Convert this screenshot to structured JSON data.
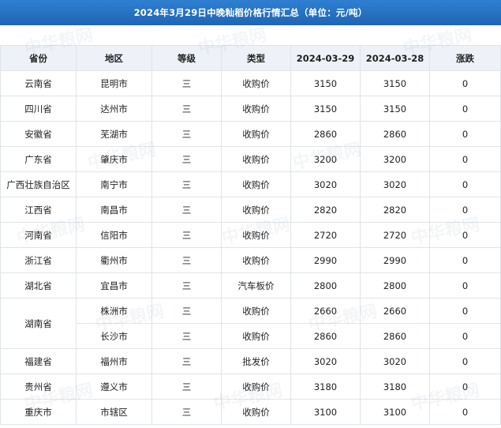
{
  "title": "2024年3月29日中晚籼稻价格行情汇总（单位：元/吨）",
  "watermark_text": "中华粮网",
  "headers": [
    "省份",
    "地区",
    "等级",
    "类型",
    "2024-03-29",
    "2024-03-28",
    "涨跌"
  ],
  "rows": [
    {
      "province": "云南省",
      "area": "昆明市",
      "grade": "三",
      "type": "收购价",
      "d1": "3150",
      "d2": "3150",
      "change": "0"
    },
    {
      "province": "四川省",
      "area": "达州市",
      "grade": "三",
      "type": "收购价",
      "d1": "3150",
      "d2": "3150",
      "change": "0"
    },
    {
      "province": "安徽省",
      "area": "芜湖市",
      "grade": "三",
      "type": "收购价",
      "d1": "2860",
      "d2": "2860",
      "change": "0"
    },
    {
      "province": "广东省",
      "area": "肇庆市",
      "grade": "三",
      "type": "收购价",
      "d1": "3200",
      "d2": "3200",
      "change": "0"
    },
    {
      "province": "广西壮族自治区",
      "area": "南宁市",
      "grade": "三",
      "type": "收购价",
      "d1": "3020",
      "d2": "3020",
      "change": "0"
    },
    {
      "province": "江西省",
      "area": "南昌市",
      "grade": "三",
      "type": "收购价",
      "d1": "2820",
      "d2": "2820",
      "change": "0"
    },
    {
      "province": "河南省",
      "area": "信阳市",
      "grade": "三",
      "type": "收购价",
      "d1": "2720",
      "d2": "2720",
      "change": "0"
    },
    {
      "province": "浙江省",
      "area": "衢州市",
      "grade": "三",
      "type": "收购价",
      "d1": "2990",
      "d2": "2990",
      "change": "0"
    },
    {
      "province": "湖北省",
      "area": "宜昌市",
      "grade": "三",
      "type": "汽车板价",
      "d1": "2800",
      "d2": "2800",
      "change": "0"
    },
    {
      "province": "湖南省",
      "area": "株洲市",
      "grade": "三",
      "type": "收购价",
      "d1": "2660",
      "d2": "2660",
      "change": "0"
    },
    {
      "province": "",
      "area": "长沙市",
      "grade": "三",
      "type": "收购价",
      "d1": "2860",
      "d2": "2860",
      "change": "0"
    },
    {
      "province": "福建省",
      "area": "福州市",
      "grade": "三",
      "type": "批发价",
      "d1": "3020",
      "d2": "3020",
      "change": "0"
    },
    {
      "province": "贵州省",
      "area": "遵义市",
      "grade": "三",
      "type": "收购价",
      "d1": "3180",
      "d2": "3180",
      "change": "0"
    },
    {
      "province": "重庆市",
      "area": "市辖区",
      "grade": "三",
      "type": "收购价",
      "d1": "3100",
      "d2": "3100",
      "change": "0"
    }
  ]
}
